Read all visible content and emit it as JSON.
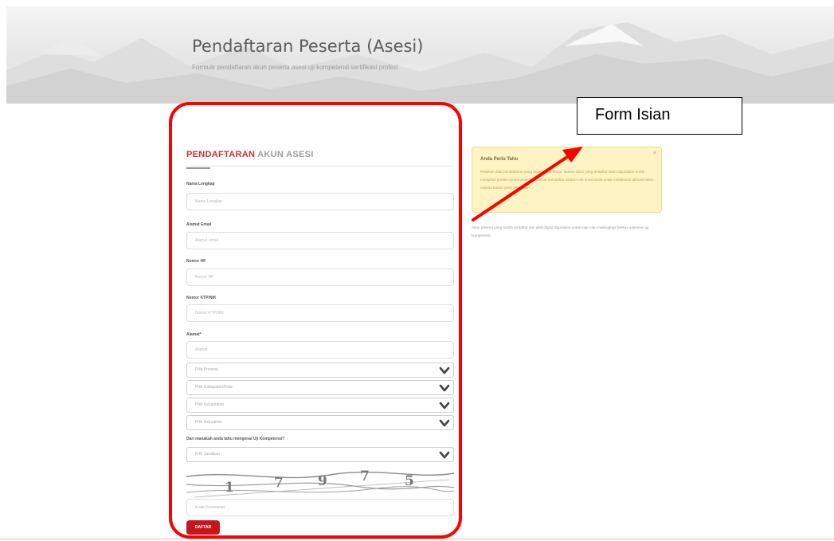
{
  "header": {
    "title": "Pendaftaran Peserta (Asesi)",
    "subtitle": "Formulir pendaftaran akun peserta asesi uji kompetensi sertifikasi profesi"
  },
  "form": {
    "heading_red": "PENDAFTARAN",
    "heading_grey": " AKUN ASESI",
    "fields": [
      {
        "label": "Nama Lengkap",
        "placeholder": "Nama Lengkap"
      },
      {
        "label": "Alamat Email",
        "placeholder": "Alamat email"
      },
      {
        "label": "Nomor HP",
        "placeholder": "Nomor HP"
      },
      {
        "label": "Nomor KTP/NIK",
        "placeholder": "Nomor KTP/NIK"
      },
      {
        "label": "Alamat*",
        "placeholder": "Alamat"
      }
    ],
    "selects": [
      {
        "value": "Pilih Provinsi"
      },
      {
        "value": "Pilih Kabupaten/Kota"
      },
      {
        "value": "Pilih Kecamatan"
      },
      {
        "value": "Pilih Kelurahan"
      }
    ],
    "question_label": "Dari manakah anda tahu mengenai Uji Kompetensi?",
    "question_select": "Pilih Jawaban",
    "captcha_digits": [
      "1",
      "7",
      "9",
      "7",
      "5"
    ],
    "captcha_placeholder": "Kode Keamanan",
    "submit_label": "DAFTAR"
  },
  "info_panel": {
    "title": "Anda Perlu Tahu",
    "close": "×",
    "body": "Pastikan data pendaftaran yang anda isikan benar, karena akun yang terdaftar akan digunakan untuk mengikuti proses uji kompetensi. Setelah mendaftar silakan cek email anda untuk melakukan aktivasi akun melalui tautan yang dikirimkan.",
    "note": "Akun peserta yang sudah terdaftar dan aktif dapat digunakan untuk login dan melengkapi berkas asesmen uji kompetensi."
  },
  "annotation": {
    "callout_text": "Form Isian",
    "highlight_color": "#ff0000"
  },
  "colors": {
    "accent": "#c4161c",
    "info_bg": "#fdf3c3"
  }
}
